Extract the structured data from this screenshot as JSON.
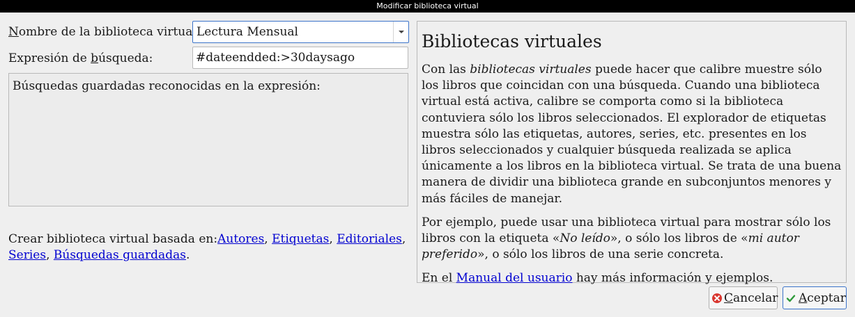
{
  "window": {
    "title": "Modificar biblioteca virtual"
  },
  "form": {
    "name_label_mnemonic": "N",
    "name_label_rest": "ombre de la biblioteca virtual:",
    "name_value": "Lectura Mensual",
    "search_label_pre": "Expresión de ",
    "search_label_mnemonic": "b",
    "search_label_post": "úsqueda:",
    "search_value": "#dateendded:>30daysago",
    "saved_searches_text": "Búsquedas guardadas reconocidas en la expresión:"
  },
  "create": {
    "prefix": "Crear biblioteca virtual basada en:",
    "links": [
      "Autores",
      "Etiquetas",
      "Editoriales",
      "Series",
      "Búsquedas guardadas"
    ],
    "sep": ", ",
    "end": "."
  },
  "help": {
    "title": "Bibliotecas virtuales",
    "p1_pre": "Con las ",
    "p1_em": "bibliotecas virtuales",
    "p1_post": " puede hacer que calibre muestre sólo los libros que coincidan con una búsqueda. Cuando una biblioteca virtual está activa, calibre se comporta como si la biblioteca contuviera sólo los libros seleccionados. El explorador de etiquetas muestra sólo las etiquetas, autores, series, etc. presentes en los libros seleccionados y cualquier búsqueda realizada se aplica únicamente a los libros en la biblioteca virtual. Se trata de una buena manera de dividir una biblioteca grande en subconjuntos menores y más fáciles de manejar.",
    "p2_a": "Por ejemplo, puede usar una biblioteca virtual para mostrar sólo los libros con la etiqueta «",
    "p2_em1": "No leído",
    "p2_b": "», o sólo los libros de «",
    "p2_em2": "mi autor preferido",
    "p2_c": "», o sólo los libros de una serie concreta.",
    "p3_pre": "En el ",
    "p3_link": "Manual del usuario",
    "p3_post": " hay más información y ejemplos."
  },
  "buttons": {
    "cancel_mnemonic": "C",
    "cancel_rest": "ancelar",
    "ok_mnemonic": "A",
    "ok_rest": "ceptar"
  },
  "colors": {
    "link": "#0000d0",
    "focus": "#3b73c9",
    "cancel_icon": "#d9362f",
    "ok_icon": "#2e9a3a"
  }
}
